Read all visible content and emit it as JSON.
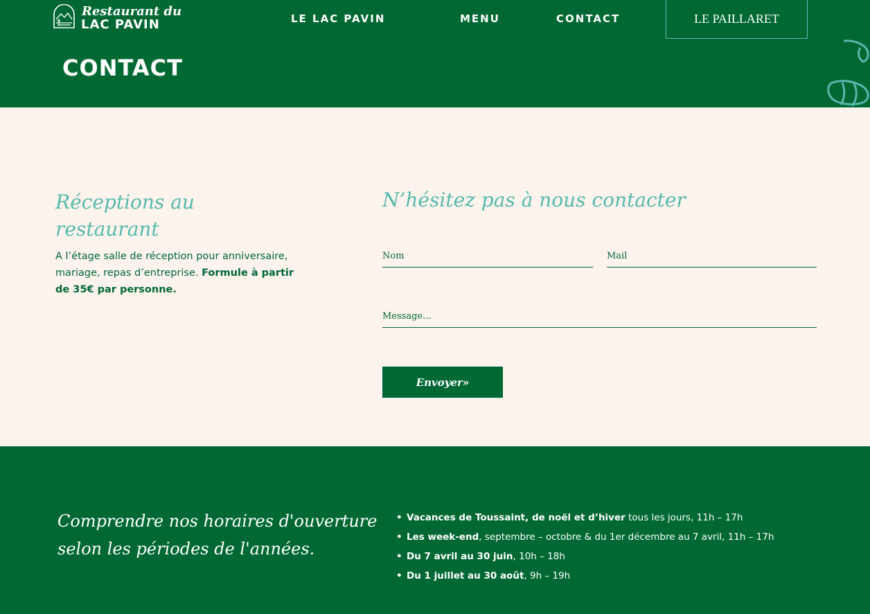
{
  "header": {
    "logo_line1": "Restaurant du",
    "logo_line2": "LAC PAVIN",
    "nav": [
      {
        "label": "LE LAC PAVIN"
      },
      {
        "label": "MENU"
      },
      {
        "label": "CONTACT"
      }
    ],
    "nav_button": "LE PAILLARET",
    "page_title": "CONTACT"
  },
  "receptions": {
    "heading": "Réceptions au restaurant",
    "text": "A l’étage salle de réception pour anniversaire, mariage, repas d’entreprise.",
    "text_bold": "Formule à partir de 35€ par personne."
  },
  "contact_form": {
    "heading": "N’hésitez pas à nous contacter",
    "name_placeholder": "Nom",
    "mail_placeholder": "Mail",
    "message_placeholder": "Message...",
    "submit_label": "Envoyer»"
  },
  "hours": {
    "heading": "Comprendre nos horaires d'ouverture selon les périodes de l'années.",
    "bullet": "•",
    "items": [
      {
        "bold": "Vacances de Toussaint, de noël et d’hiver",
        "rest": "tous les jours, 11h – 17h"
      },
      {
        "bold": "Les week-end",
        "rest": ", septembre – octobre & du 1er décembre au 7 avril, 11h – 17h"
      },
      {
        "bold": "Du 7 avril au 30 juin",
        "rest": ", 10h – 18h"
      },
      {
        "bold": "Du 1 juillet au 30 août",
        "rest": ", 9h – 19h"
      }
    ]
  },
  "colors": {
    "brand_green": "#006933",
    "accent_teal": "#55b9ac",
    "background_cream": "#fbf3ec"
  },
  "icons": {
    "logo": "lake-mountain-logo-icon",
    "decoration": "bee-outline-icon"
  }
}
